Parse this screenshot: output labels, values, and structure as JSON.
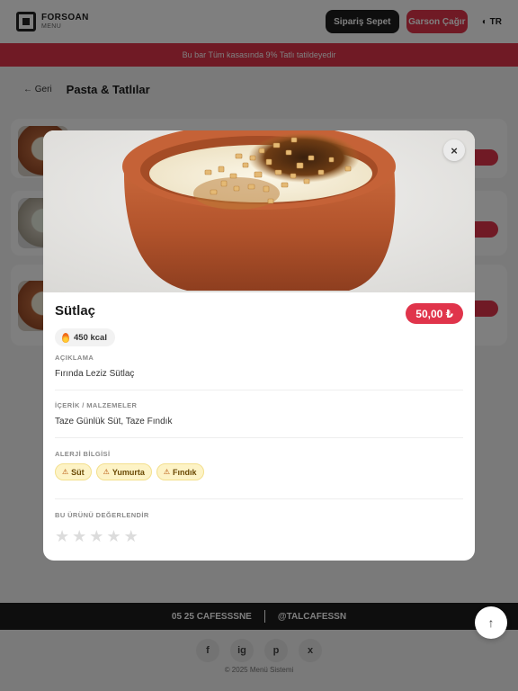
{
  "header": {
    "brand_name": "FORSOAN",
    "brand_sub": "MENU",
    "cart_label": "Sipariş Sepet",
    "call_label": "Garson Çağır",
    "language": "TR"
  },
  "announcement": "Bu bar Tüm kasasında 9% Tatlı tatildeyedir",
  "breadcrumb": {
    "back_label": "← Geri",
    "category_title": "Pasta & Tatlılar"
  },
  "footer": {
    "phone_label": "05 25 CAFESSSNE",
    "web_label": "@TALCAFESSN",
    "social_icons": [
      "f",
      "ig",
      "p",
      "x"
    ],
    "copyright": "© 2025 Menü Sistemi"
  },
  "modal": {
    "close_label": "×",
    "title": "Sütlaç",
    "price": "50,00 ₺",
    "calories": "450 kcal",
    "description": {
      "label": "AÇIKLAMA",
      "text": "Fırında Leziz Sütlaç"
    },
    "ingredients": {
      "label": "İÇERİK / MALZEMELER",
      "text": "Taze Günlük Süt, Taze Fındık"
    },
    "allergens": {
      "label": "ALERJİ BİLGİSİ",
      "items": [
        "Süt",
        "Yumurta",
        "Fındık"
      ],
      "icon": "⚠"
    },
    "rating": {
      "label": "BU ÜRÜNÜ DEĞERLENDİR",
      "max_stars": 5,
      "value": 0
    }
  },
  "colors": {
    "accent": "#e0344b",
    "dark": "#1d1d1d",
    "tag_bg": "#fdf3c6"
  }
}
